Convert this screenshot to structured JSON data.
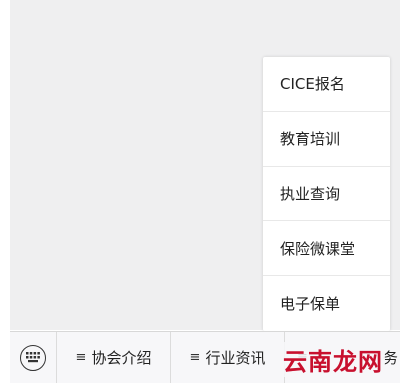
{
  "menu": {
    "items": [
      {
        "label": "CICE报名"
      },
      {
        "label": "教育培训"
      },
      {
        "label": "执业查询"
      },
      {
        "label": "保险微课堂"
      },
      {
        "label": "电子保单"
      }
    ]
  },
  "bottom_bar": {
    "keyboard_icon": "keyboard-icon",
    "tabs": [
      {
        "icon": "≡",
        "label": "协会介绍"
      },
      {
        "icon": "≡",
        "label": "行业资讯"
      },
      {
        "icon": "≡",
        "label": "务"
      }
    ]
  },
  "watermark": {
    "text": "云南龙网"
  }
}
